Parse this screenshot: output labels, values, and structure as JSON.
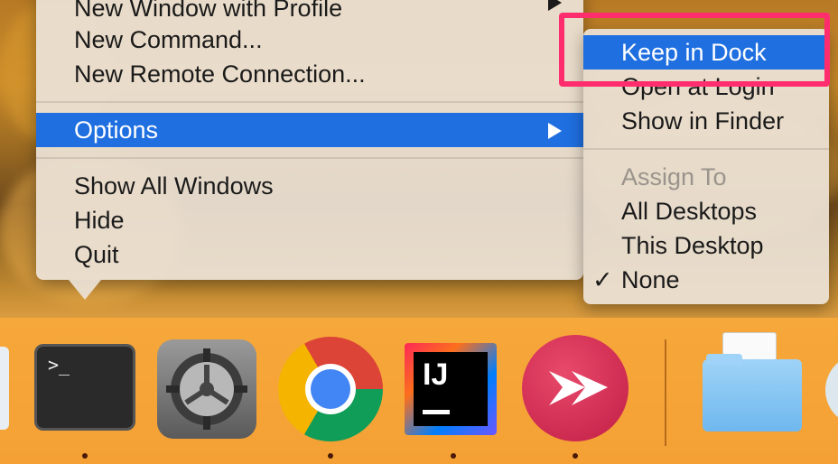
{
  "context_menu": {
    "items": [
      {
        "label": "New Window with Profile"
      },
      {
        "label": "New Command..."
      },
      {
        "label": "New Remote Connection..."
      },
      {
        "label": "Options"
      },
      {
        "label": "Show All Windows"
      },
      {
        "label": "Hide"
      },
      {
        "label": "Quit"
      }
    ]
  },
  "options_submenu": {
    "items": [
      {
        "label": "Keep in Dock"
      },
      {
        "label": "Open at Login"
      },
      {
        "label": "Show in Finder"
      },
      {
        "label": "Assign To"
      },
      {
        "label": "All Desktops"
      },
      {
        "label": "This Desktop"
      },
      {
        "label": "None",
        "checked": true
      }
    ],
    "checkmark": "✓"
  },
  "dock": {
    "apps": [
      {
        "name": "terminal-icon",
        "glyph": ">_"
      },
      {
        "name": "system-preferences-icon"
      },
      {
        "name": "chrome-icon"
      },
      {
        "name": "intellij-icon",
        "glyph": "IJ"
      },
      {
        "name": "skitch-icon"
      },
      {
        "name": "folder-icon"
      }
    ]
  },
  "colors": {
    "highlight": "#1f6fe0",
    "annotation_box": "#ff2d6e",
    "dock": "#f4a035"
  }
}
